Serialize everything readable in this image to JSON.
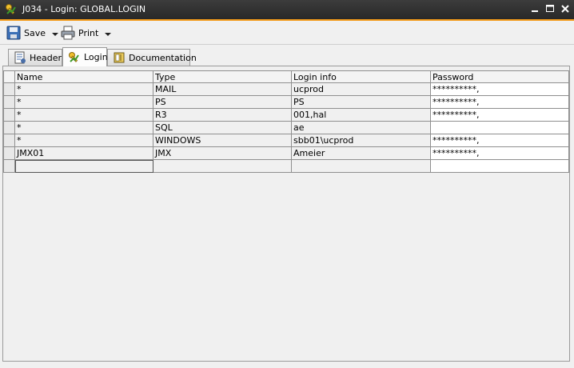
{
  "window": {
    "title": "J034 - Login: GLOBAL.LOGIN",
    "icon": "login-key-icon",
    "controls": [
      "minimize-icon",
      "maximize-icon",
      "close-icon"
    ]
  },
  "toolbar": {
    "save_label": "Save",
    "print_label": "Print"
  },
  "tabs": [
    {
      "label": "Header",
      "icon": "header-doc-icon",
      "active": false
    },
    {
      "label": "Login",
      "icon": "login-key-icon",
      "active": true
    },
    {
      "label": "Documentation",
      "icon": "book-icon",
      "active": false
    }
  ],
  "table": {
    "columns": [
      "Name",
      "Type",
      "Login info",
      "Password"
    ],
    "rows": [
      {
        "name": "*",
        "type": "MAIL",
        "login_info": "ucprod",
        "password": "**********,"
      },
      {
        "name": "*",
        "type": "PS",
        "login_info": "PS",
        "password": "**********,"
      },
      {
        "name": "*",
        "type": "R3",
        "login_info": "001,hal",
        "password": "**********,"
      },
      {
        "name": "*",
        "type": "SQL",
        "login_info": "ae",
        "password": ""
      },
      {
        "name": "*",
        "type": "WINDOWS",
        "login_info": "sbb01\\ucprod",
        "password": "**********,"
      },
      {
        "name": "JMX01",
        "type": "JMX",
        "login_info": "Ameier",
        "password": "**********,"
      },
      {
        "name": "",
        "type": "",
        "login_info": "",
        "password": ""
      }
    ]
  },
  "colors": {
    "titlebar": "#2f2f2f",
    "accent": "#f39a1a",
    "background": "#f0f0f0"
  }
}
